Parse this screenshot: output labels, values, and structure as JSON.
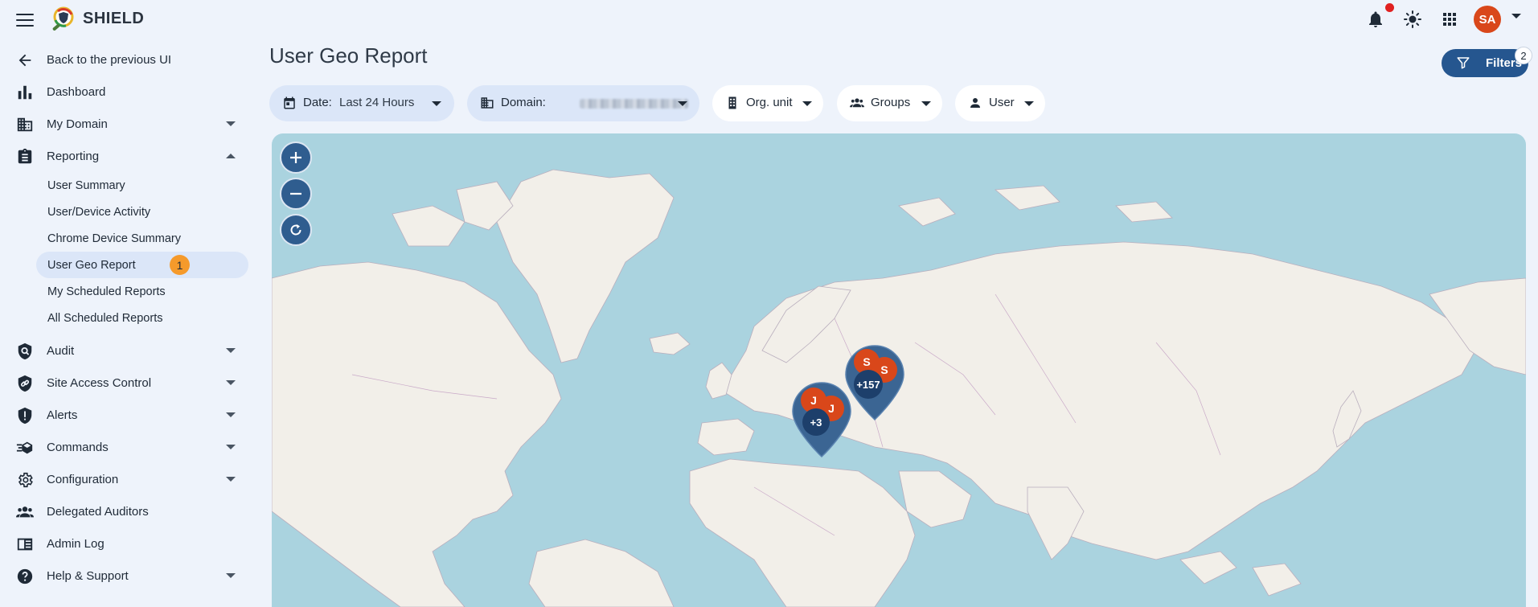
{
  "app": {
    "title": "SHIELD",
    "avatar_initials": "SA"
  },
  "sidebar": {
    "back_label": "Back to the previous UI",
    "items": [
      {
        "label": "Dashboard",
        "icon": "bar-chart-icon"
      },
      {
        "label": "My Domain",
        "icon": "building-icon"
      },
      {
        "label": "Reporting",
        "icon": "clipboard-icon"
      },
      {
        "label": "Audit",
        "icon": "audit-search-icon"
      },
      {
        "label": "Site Access Control",
        "icon": "link-shield-icon"
      },
      {
        "label": "Alerts",
        "icon": "shield-alert-icon"
      },
      {
        "label": "Commands",
        "icon": "commands-icon"
      },
      {
        "label": "Configuration",
        "icon": "gear-icon"
      },
      {
        "label": "Delegated Auditors",
        "icon": "people-icon"
      },
      {
        "label": "Admin Log",
        "icon": "log-book-icon"
      },
      {
        "label": "Help & Support",
        "icon": "help-icon"
      }
    ],
    "reporting_sub": [
      "User Summary",
      "User/Device Activity",
      "Chrome Device Summary",
      "User Geo Report",
      "My Scheduled Reports",
      "All Scheduled Reports"
    ],
    "active_badge": "1"
  },
  "main": {
    "page_title": "User Geo Report",
    "filters_label": "Filters",
    "filters_count": "2",
    "chips": {
      "date_label": "Date:",
      "date_value": "Last 24 Hours",
      "domain_label": "Domain:",
      "org_unit": "Org. unit",
      "groups": "Groups",
      "user": "User"
    }
  },
  "map": {
    "clusters": [
      {
        "avatars": [
          "J",
          "J"
        ],
        "more": "+3"
      },
      {
        "avatars": [
          "S",
          "S"
        ],
        "more": "+157"
      }
    ],
    "colors": {
      "water": "#aad3df",
      "land": "#f2efe9",
      "marker": "#3b6593",
      "avatar": "#d9471a",
      "count": "#1d3f6b"
    }
  }
}
